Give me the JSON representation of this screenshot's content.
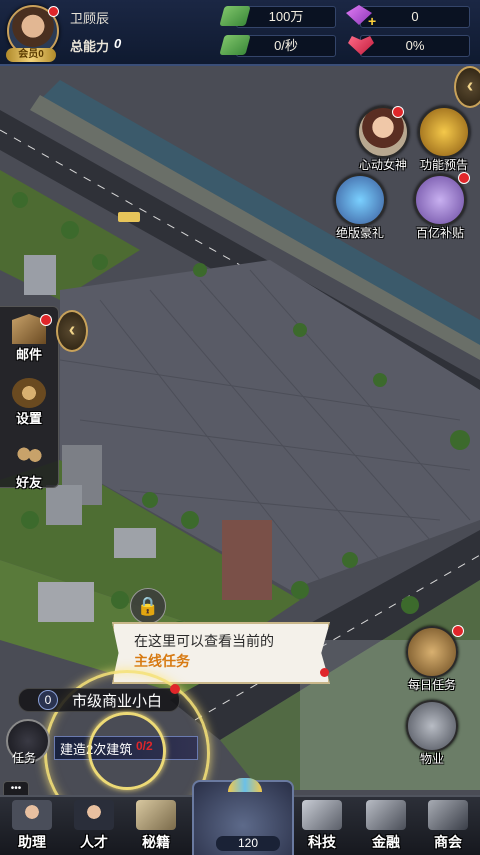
{
  "player": {
    "name": "卫顾辰",
    "vip_label": "会员0",
    "power_label": "总能力",
    "power_value": "0"
  },
  "resources": {
    "money": "100万",
    "gems": "0",
    "income": "0/秒",
    "charm": "0%"
  },
  "right_menu": [
    {
      "label": "心动女神",
      "icon": "goddess-portrait-icon"
    },
    {
      "label": "功能预告",
      "icon": "trumpet-icon"
    },
    {
      "label": "绝版豪礼",
      "icon": "gift-gems-icon"
    },
    {
      "label": "百亿补贴",
      "icon": "subsidy-chest-icon"
    },
    {
      "label": "每日任务",
      "icon": "book-icon"
    },
    {
      "label": "物业",
      "icon": "building-icon"
    }
  ],
  "left_menu": [
    {
      "label": "邮件",
      "icon": "mail-icon"
    },
    {
      "label": "设置",
      "icon": "gear-icon"
    },
    {
      "label": "好友",
      "icon": "friends-icon"
    }
  ],
  "tooltip": {
    "line1": "在这里可以查看当前的",
    "line2": "主线任务"
  },
  "level": {
    "number": "0",
    "title": "市级商业小白"
  },
  "task": {
    "label": "任务",
    "text": "建造2次建筑",
    "progress": "0/2"
  },
  "chat_icon": "chat-icon",
  "bottom_nav": [
    {
      "label": "助理",
      "icon": "assistant-icon"
    },
    {
      "label": "人才",
      "icon": "talent-icon"
    },
    {
      "label": "秘籍",
      "icon": "secret-book-icon"
    },
    {
      "label": "科技",
      "icon": "tech-icon"
    },
    {
      "label": "金融",
      "icon": "finance-icon"
    },
    {
      "label": "商会",
      "icon": "chamber-icon"
    }
  ],
  "center_nav": {
    "count": "120",
    "icon": "food-truck-icon"
  },
  "colors": {
    "accent_gold": "#c9a05a",
    "badge_red": "#e0262a",
    "task_orange": "#d77a12"
  }
}
